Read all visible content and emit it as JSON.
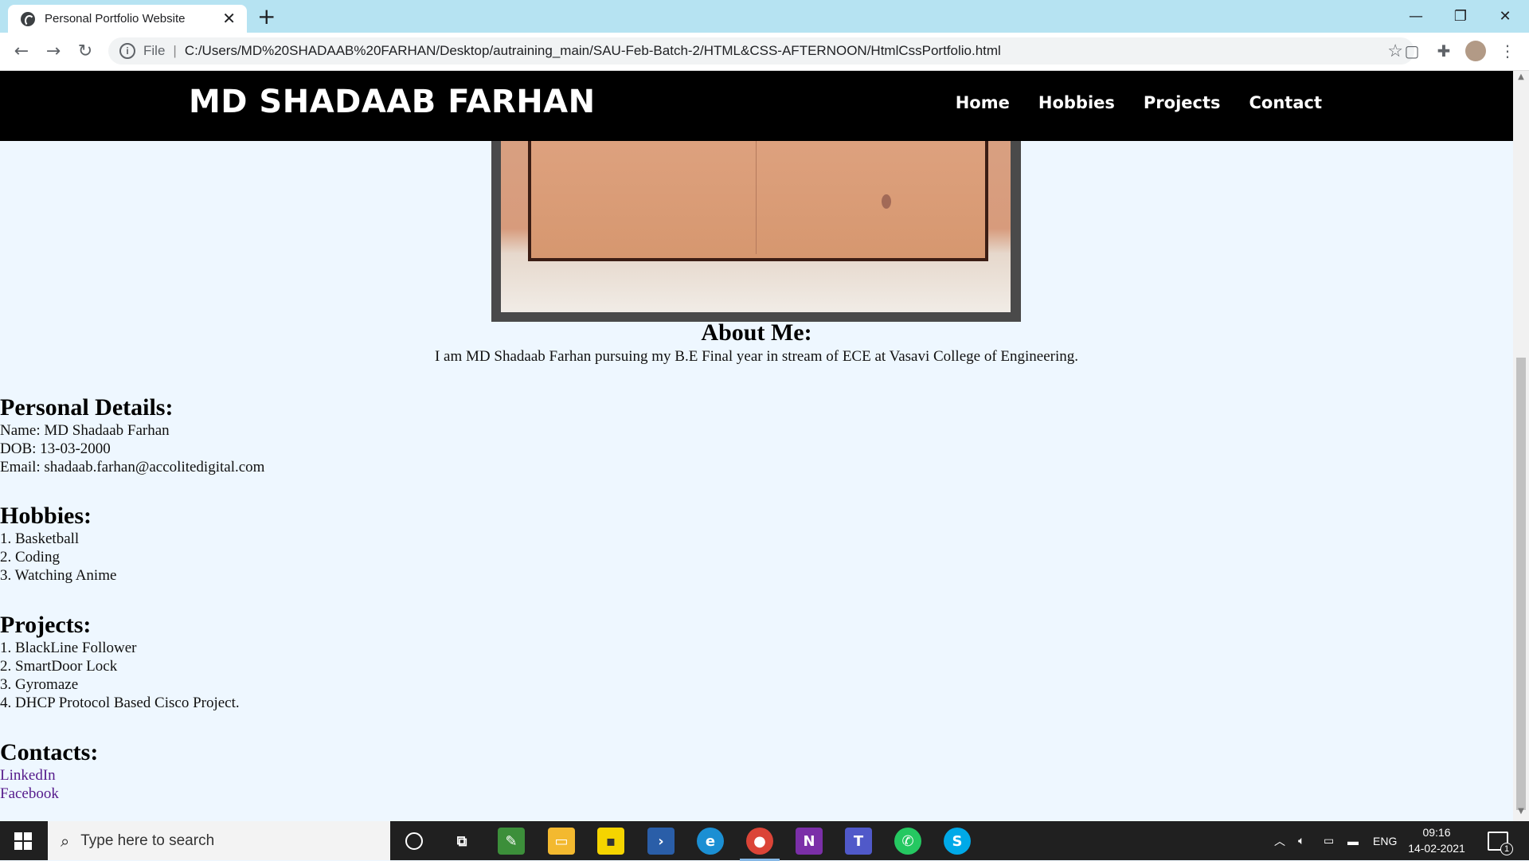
{
  "browser": {
    "tab_title": "Personal Portfolio Website",
    "tab_close": "✕",
    "new_tab": "+",
    "scheme_label": "File",
    "url": "C:/Users/MD%20SHADAAB%20FARHAN/Desktop/autraining_main/SAU-Feb-Batch-2/HTML&CSS-AFTERNOON/HtmlCssPortfolio.html",
    "window_controls": {
      "minimize": "—",
      "restore": "❐",
      "close": "✕"
    }
  },
  "site": {
    "brand": "MD SHADAAB FARHAN",
    "nav": [
      "Home",
      "Hobbies",
      "Projects",
      "Contact"
    ]
  },
  "about": {
    "title": "About Me:",
    "text": "I am MD Shadaab Farhan pursuing my B.E Final year in stream of ECE at Vasavi College of Engineering."
  },
  "personal": {
    "title": "Personal Details:",
    "lines": [
      "Name: MD Shadaab Farhan",
      "DOB: 13-03-2000",
      "Email: shadaab.farhan@accolitedigital.com"
    ]
  },
  "hobbies": {
    "title": "Hobbies:",
    "lines": [
      "1. Basketball",
      "2. Coding",
      "3. Watching Anime"
    ]
  },
  "projects": {
    "title": "Projects:",
    "lines": [
      "1. BlackLine Follower",
      "2. SmartDoor Lock",
      "3. Gyromaze",
      "4. DHCP Protocol Based Cisco Project."
    ]
  },
  "contacts": {
    "title": "Contacts:",
    "links": [
      "LinkedIn",
      "Facebook"
    ]
  },
  "taskbar": {
    "search_placeholder": "Type here to search",
    "apps": [
      "cortana-icon",
      "task-view-icon",
      "image-editor-icon",
      "file-explorer-icon",
      "sticky-notes-icon",
      "powershell-icon",
      "edge-icon",
      "chrome-icon",
      "onenote-icon",
      "teams-icon",
      "whatsapp-icon",
      "skype-icon"
    ],
    "language": "ENG",
    "time": "09:16",
    "date": "14-02-2021",
    "notification_count": "1"
  },
  "colors": {
    "header_bg": "#000000",
    "page_bg": "#eef7ff",
    "tabstrip": "#b6e3f2",
    "visited_link": "#551a8b"
  }
}
